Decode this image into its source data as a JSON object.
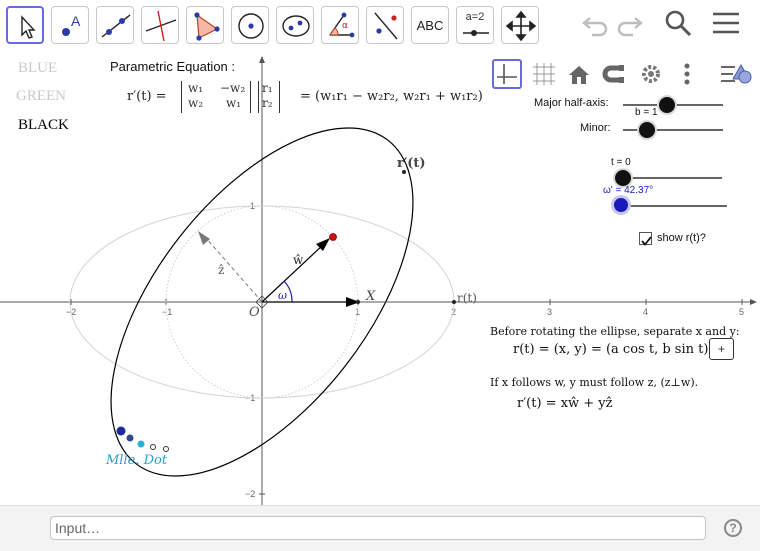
{
  "toolbar": {
    "tools": [
      {
        "name": "move-tool",
        "label": ""
      },
      {
        "name": "point-tool",
        "label": "A"
      },
      {
        "name": "line-tool",
        "label": ""
      },
      {
        "name": "perpendicular-line-tool",
        "label": ""
      },
      {
        "name": "polygon-tool",
        "label": ""
      },
      {
        "name": "circle-tool",
        "label": ""
      },
      {
        "name": "ellipse-tool",
        "label": ""
      },
      {
        "name": "angle-tool",
        "label": "α"
      },
      {
        "name": "reflect-tool",
        "label": ""
      },
      {
        "name": "text-tool",
        "label": "ABC"
      },
      {
        "name": "slider-tool",
        "label": "a=2"
      },
      {
        "name": "move-graphics-view-tool",
        "label": ""
      }
    ],
    "icons": [
      "undo-icon",
      "redo-icon",
      "search-icon",
      "menu-icon"
    ]
  },
  "graphics_bar": {
    "icons": [
      "axes-icon",
      "grid-icon",
      "home-icon",
      "magnet-icon",
      "gear-icon",
      "more-icon",
      "style-bar-icon"
    ]
  },
  "legend": {
    "blue": "BLUE",
    "green": "GREEN",
    "black": "BLACK",
    "colors": {
      "blue": "#c9c9c9",
      "green": "#c9c9c9",
      "black": "#000000"
    }
  },
  "equation": {
    "title": "Parametric Equation :",
    "lhs": "r′(t) =",
    "matrix": [
      "w₁",
      "−w₂",
      "w₂",
      "w₁"
    ],
    "vector": [
      "r₁",
      "r₂"
    ],
    "result": "= (w₁r₁ − w₂r₂,   w₂r₁ + w₁r₂)"
  },
  "sliders": {
    "major_label": "Major half-axis:",
    "b_label": "b = 1",
    "minor_label": "Minor:",
    "t_label": "t = 0",
    "omega_label": "ω' = 42.37°",
    "major_value": 0.45,
    "minor_value": 0.25,
    "t_value": 0.0,
    "omega_value": 0.12
  },
  "checkbox": {
    "label": "show r(t)?",
    "checked": true
  },
  "axes": {
    "x_ticks": [
      "−2",
      "−1",
      "1",
      "2",
      "3",
      "4",
      "5"
    ],
    "y_ticks": [
      "1",
      "−1",
      "−2"
    ],
    "origin": "O"
  },
  "labels": {
    "r_prime": "r′(t)",
    "r": "r(t)",
    "x": "X",
    "w": "ŵ",
    "z": "ẑ",
    "omega": "ω",
    "dot": "Mlle. Dot"
  },
  "notes": {
    "line1": "Before rotating the ellipse, separate x and y:",
    "line2": "r(t) = (x, y) = (a cos t,  b sin t)",
    "plus": "+",
    "line3": "If x follows  w,  y must follow  z,  (z⊥w).",
    "line4": "r′(t) = xŵ + yẑ"
  },
  "input": {
    "placeholder": "Input…"
  },
  "help": "?",
  "colors": {
    "accent": "#6a6ad8",
    "ellipse": "#000000",
    "circle": "#d6d6d6",
    "dot": "#2aa0c8",
    "point": "#d01010",
    "slider_knob": "#111111",
    "omega_knob": "#1a1ab8"
  }
}
